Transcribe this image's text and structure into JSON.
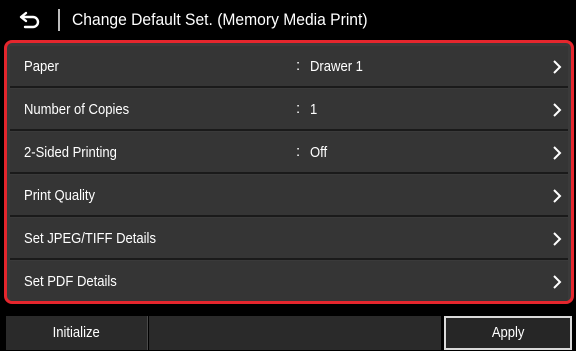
{
  "header": {
    "back_icon": "back-arrow-icon",
    "title": "Change Default Set. (Memory Media Print)"
  },
  "settings": [
    {
      "label": "Paper",
      "colon": ":",
      "value": "Drawer 1"
    },
    {
      "label": "Number of Copies",
      "colon": ":",
      "value": "1"
    },
    {
      "label": "2-Sided Printing",
      "colon": ":",
      "value": "Off"
    },
    {
      "label": "Print Quality",
      "colon": "",
      "value": ""
    },
    {
      "label": "Set JPEG/TIFF Details",
      "colon": "",
      "value": ""
    },
    {
      "label": "Set PDF Details",
      "colon": "",
      "value": ""
    }
  ],
  "footer": {
    "initialize_label": "Initialize",
    "apply_label": "Apply"
  },
  "colors": {
    "highlight_border": "#e5262d",
    "row_background": "#353535",
    "screen_background": "#000000"
  }
}
